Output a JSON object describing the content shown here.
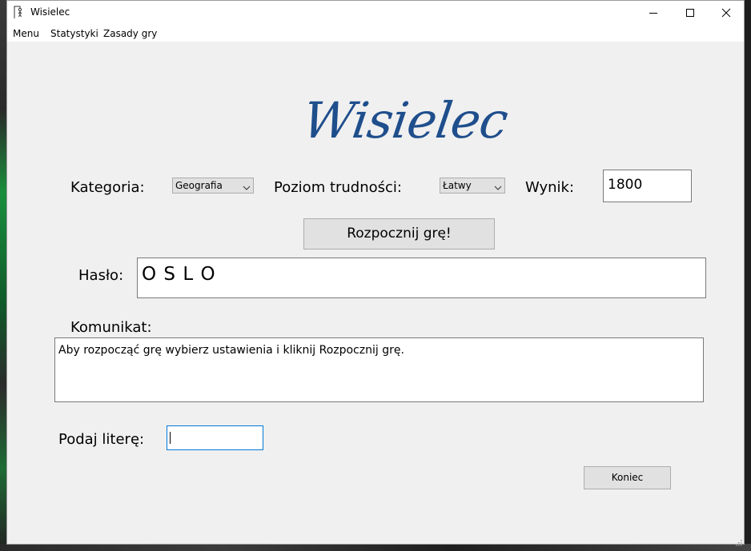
{
  "window": {
    "title": "Wisielec"
  },
  "menu": {
    "items": [
      "Menu",
      "Statystyki",
      "Zasady gry"
    ]
  },
  "logo": {
    "text": "Wisielec"
  },
  "settings": {
    "category_label": "Kategoria:",
    "category_value": "Geografia",
    "difficulty_label": "Poziom trudności:",
    "difficulty_value": "Łatwy",
    "score_label": "Wynik:",
    "score_value": "1800"
  },
  "start_button": {
    "label": "Rozpocznij grę!"
  },
  "password": {
    "label": "Hasło:",
    "value": "O S L O"
  },
  "message": {
    "label": "Komunikat:",
    "text": "Aby rozpocząć grę wybierz ustawienia i kliknij Rozpocznij grę."
  },
  "letter": {
    "label": "Podaj literę:",
    "value": ""
  },
  "end_button": {
    "label": "Koniec"
  },
  "colors": {
    "logo": "#1f4e8c",
    "window_bg": "#f0f0f0",
    "focus_border": "#0078d7"
  }
}
